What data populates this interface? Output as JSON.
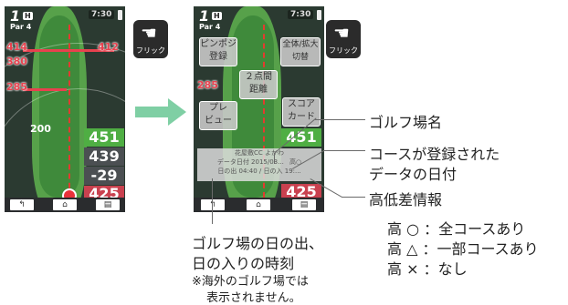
{
  "left_screen": {
    "hole_number": "1",
    "hole_badge": "H",
    "par": "Par 4",
    "clock": "7:30",
    "yard_top_left": "414",
    "yard_top_right": "412",
    "yard_second": "380",
    "yard_mid": "285",
    "ring_label": "200",
    "score_values": [
      "451",
      "439",
      "-29",
      "425"
    ],
    "bottom_buttons": [
      "↰",
      "⌂",
      "▤"
    ]
  },
  "flick_label": "フリック",
  "right_screen": {
    "hole_number": "1",
    "hole_badge": "H",
    "par": "Par 4",
    "clock": "7:30",
    "yard_mid": "285",
    "btn_pinpos": "ピンポジ\n登録",
    "btn_zoom": "全体/拡大\n切替",
    "btn_distance": "２点間\n距離",
    "btn_preview": "プレ\nビュー",
    "btn_scorecard": "スコア\nカード",
    "score_top": "451",
    "score_bottom": "425",
    "info_course": "花屋敷CC よかわ",
    "info_date": "データ日付 2015/03...",
    "info_elev": "高○",
    "info_sun": "日の出 04:40 / 日の入 19:...",
    "bottom_buttons": [
      "↰",
      "⌂",
      "▤"
    ]
  },
  "callouts": {
    "course_name": "ゴルフ場名",
    "data_date_1": "コースが登録された",
    "data_date_2": "データの日付",
    "elevation_title": "高低差情報",
    "elev_full": "高 ○ ：全コースあり",
    "elev_partial": "高 △ ：一部コースあり",
    "elev_none": "高 × ：なし",
    "sun_1": "ゴルフ場の日の出、",
    "sun_2": "日の入りの時刻",
    "sun_note_1": "※海外のゴルフ場では",
    "sun_note_2": "表示されません。"
  },
  "colors": {
    "arrow": "#7fcfa4",
    "marker": "#e8414e"
  }
}
